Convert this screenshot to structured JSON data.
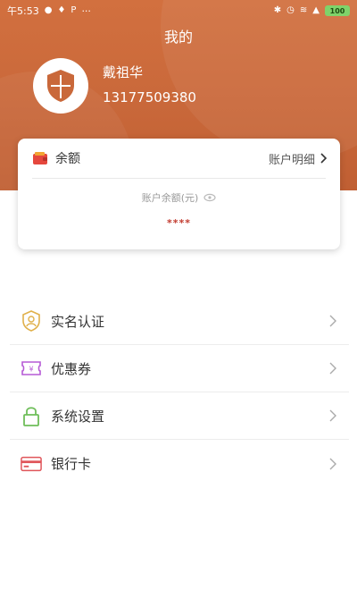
{
  "status_bar": {
    "time": "午5:53",
    "left_icons": [
      "wechat-icon",
      "drop-icon",
      "p-icon"
    ],
    "more": "···",
    "battery": "100"
  },
  "header": {
    "title": "我的"
  },
  "user": {
    "name": "戴祖华",
    "phone": "13177509380"
  },
  "balance_card": {
    "label": "余额",
    "details_label": "账户明细",
    "balance_label": "账户余额(元)",
    "balance_value": "****"
  },
  "menu": {
    "items": [
      {
        "label": "实名认证",
        "icon": "id-verify-icon",
        "color": "#e0b04a"
      },
      {
        "label": "优惠券",
        "icon": "coupon-icon",
        "color": "#b65ad6"
      },
      {
        "label": "系统设置",
        "icon": "lock-icon",
        "color": "#6fbe5a"
      },
      {
        "label": "银行卡",
        "icon": "bank-card-icon",
        "color": "#e0555a"
      }
    ]
  },
  "colors": {
    "brand": "#c9683a",
    "balance_hidden": "#c23b2f"
  }
}
